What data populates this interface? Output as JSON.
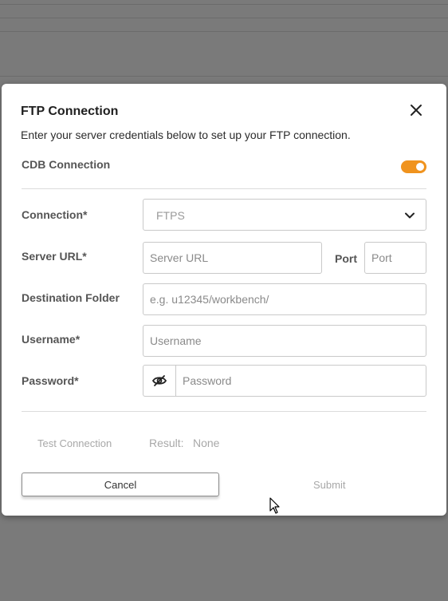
{
  "dialog": {
    "title": "FTP Connection",
    "subtitle": "Enter your server credentials below to set up your FTP connection.",
    "close_icon": "close-icon"
  },
  "cdb_toggle": {
    "label": "CDB Connection",
    "checked": true,
    "color": "#f0931e"
  },
  "form": {
    "connection": {
      "label": "Connection*",
      "value": "FTPS",
      "icon": "chevron-down-icon"
    },
    "server_url": {
      "label": "Server URL*",
      "placeholder": "Server URL"
    },
    "port": {
      "label": "Port",
      "placeholder": "Port"
    },
    "destination_folder": {
      "label": "Destination Folder",
      "placeholder": "e.g. u12345/workbench/"
    },
    "username": {
      "label": "Username*",
      "placeholder": "Username"
    },
    "password": {
      "label": "Password*",
      "placeholder": "Password",
      "icon": "eye-off-icon"
    }
  },
  "test": {
    "button_label": "Test Connection",
    "result_label": "Result:",
    "result_value": "None"
  },
  "actions": {
    "cancel_label": "Cancel",
    "submit_label": "Submit"
  }
}
